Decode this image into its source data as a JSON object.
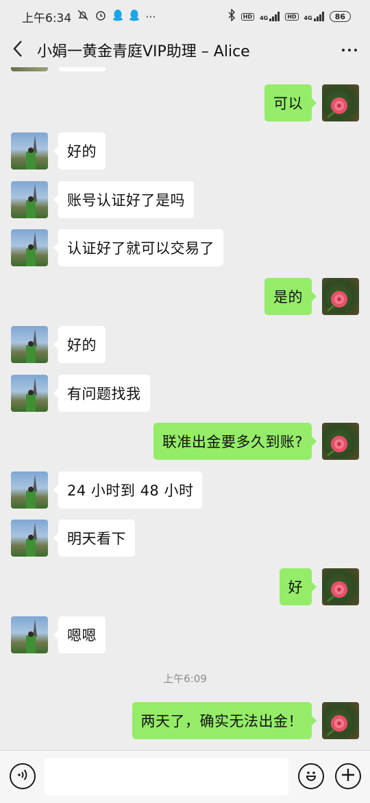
{
  "status_bar": {
    "time": "上午6:34",
    "network_left": "4G",
    "network_right": "4G",
    "hd": "HD",
    "battery": "86",
    "icons": [
      "mute-bell-icon",
      "alarm-icon",
      "qq-icon",
      "qq-icon",
      "more-dots-icon",
      "bluetooth-icon",
      "signal-icon"
    ]
  },
  "header": {
    "title": "小娟一黄金青庭VIP助理 – Alice",
    "back_icon": "chevron-left-icon",
    "more_icon": "more-horizontal-icon"
  },
  "messages": [
    {
      "side": "out",
      "text": "可以"
    },
    {
      "side": "in",
      "text": "好的"
    },
    {
      "side": "in",
      "text": "账号认证好了是吗"
    },
    {
      "side": "in",
      "text": "认证好了就可以交易了"
    },
    {
      "side": "out",
      "text": "是的"
    },
    {
      "side": "in",
      "text": "好的"
    },
    {
      "side": "in",
      "text": "有问题找我"
    },
    {
      "side": "out",
      "text": "联准出金要多久到账?"
    },
    {
      "side": "in",
      "text": "24 小时到 48 小时"
    },
    {
      "side": "in",
      "text": "明天看下"
    },
    {
      "side": "out",
      "text": "好"
    },
    {
      "side": "in",
      "text": "嗯嗯"
    },
    {
      "side": "out",
      "text": "两天了，确实无法出金！"
    }
  ],
  "timestamp": "上午6:09",
  "input_bar": {
    "voice_icon": "voice-icon",
    "emoji_icon": "emoji-icon",
    "plus_icon": "plus-icon",
    "input_value": ""
  },
  "colors": {
    "background": "#ededed",
    "outgoing_bubble": "#95ec69",
    "incoming_bubble": "#ffffff"
  }
}
